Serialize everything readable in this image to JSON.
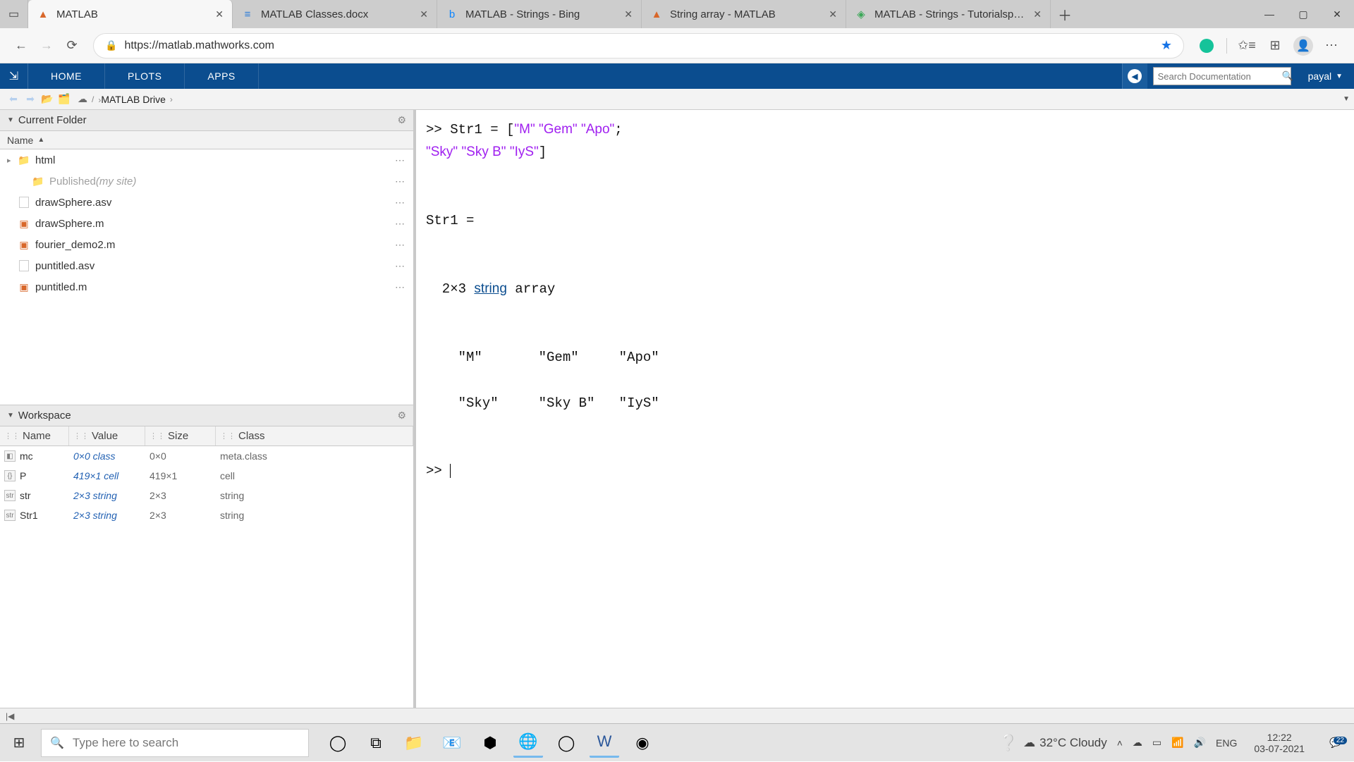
{
  "browser": {
    "tabs": [
      {
        "title": "MATLAB",
        "favicon": "▲",
        "faviconColor": "#d8672a",
        "active": true
      },
      {
        "title": "MATLAB Classes.docx",
        "favicon": "≡",
        "faviconColor": "#2a7bd8"
      },
      {
        "title": "MATLAB - Strings - Bing",
        "favicon": "b",
        "faviconColor": "#0a84ff"
      },
      {
        "title": "String array - MATLAB",
        "favicon": "▲",
        "faviconColor": "#d8672a"
      },
      {
        "title": "MATLAB - Strings - Tutorialspoin",
        "favicon": "◈",
        "faviconColor": "#3aa757"
      }
    ],
    "url": "https://matlab.mathworks.com"
  },
  "ribbon": {
    "tabs": [
      "HOME",
      "PLOTS",
      "APPS"
    ],
    "search_placeholder": "Search Documentation",
    "user": "payal"
  },
  "breadcrumb": {
    "root": "MATLAB Drive"
  },
  "currentFolder": {
    "title": "Current Folder",
    "nameHeader": "Name",
    "items": [
      {
        "name": "html",
        "type": "folder",
        "expandable": true
      },
      {
        "name": "Published",
        "suffix": "(my site)",
        "type": "folder",
        "nested": true,
        "grey": true
      },
      {
        "name": "drawSphere.asv",
        "type": "asv"
      },
      {
        "name": "drawSphere.m",
        "type": "m"
      },
      {
        "name": "fourier_demo2.m",
        "type": "m"
      },
      {
        "name": "puntitled.asv",
        "type": "asv"
      },
      {
        "name": "puntitled.m",
        "type": "m"
      }
    ]
  },
  "workspace": {
    "title": "Workspace",
    "cols": [
      "Name",
      "Value",
      "Size",
      "Class"
    ],
    "rows": [
      {
        "name": "mc",
        "value": "0×0 class",
        "size": "0×0",
        "class": "meta.class",
        "badge": "◧"
      },
      {
        "name": "P",
        "value": "419×1 cell",
        "size": "419×1",
        "class": "cell",
        "badge": "{}"
      },
      {
        "name": "str",
        "value": "2×3 string",
        "size": "2×3",
        "class": "string",
        "badge": "str"
      },
      {
        "name": "Str1",
        "value": "2×3 string",
        "size": "2×3",
        "class": "string",
        "badge": "str"
      }
    ]
  },
  "command": {
    "prompt": ">>",
    "input_tokens": [
      {
        "t": ">> Str1 = [",
        "c": "plain"
      },
      {
        "t": "\"M\" \"Gem\" \"Apo\"",
        "c": "str"
      },
      {
        "t": ";\n",
        "c": "plain"
      },
      {
        "t": "\"Sky\" \"Sky B\" \"IyS\"",
        "c": "str"
      },
      {
        "t": "]",
        "c": "plain"
      }
    ],
    "varname": "Str1 =",
    "dim_prefix": "  2×3 ",
    "dim_link": "string",
    "dim_suffix": " array",
    "matrix": [
      [
        "\"M\"",
        "\"Gem\"",
        "\"Apo\""
      ],
      [
        "\"Sky\"",
        "\"Sky B\"",
        "\"IyS\""
      ]
    ]
  },
  "footer": {
    "token": "|◀"
  },
  "taskbar": {
    "search_placeholder": "Type here to search",
    "weather": "32°C  Cloudy",
    "lang": "ENG",
    "time": "12:22",
    "date": "03-07-2021",
    "notif_count": "22"
  }
}
